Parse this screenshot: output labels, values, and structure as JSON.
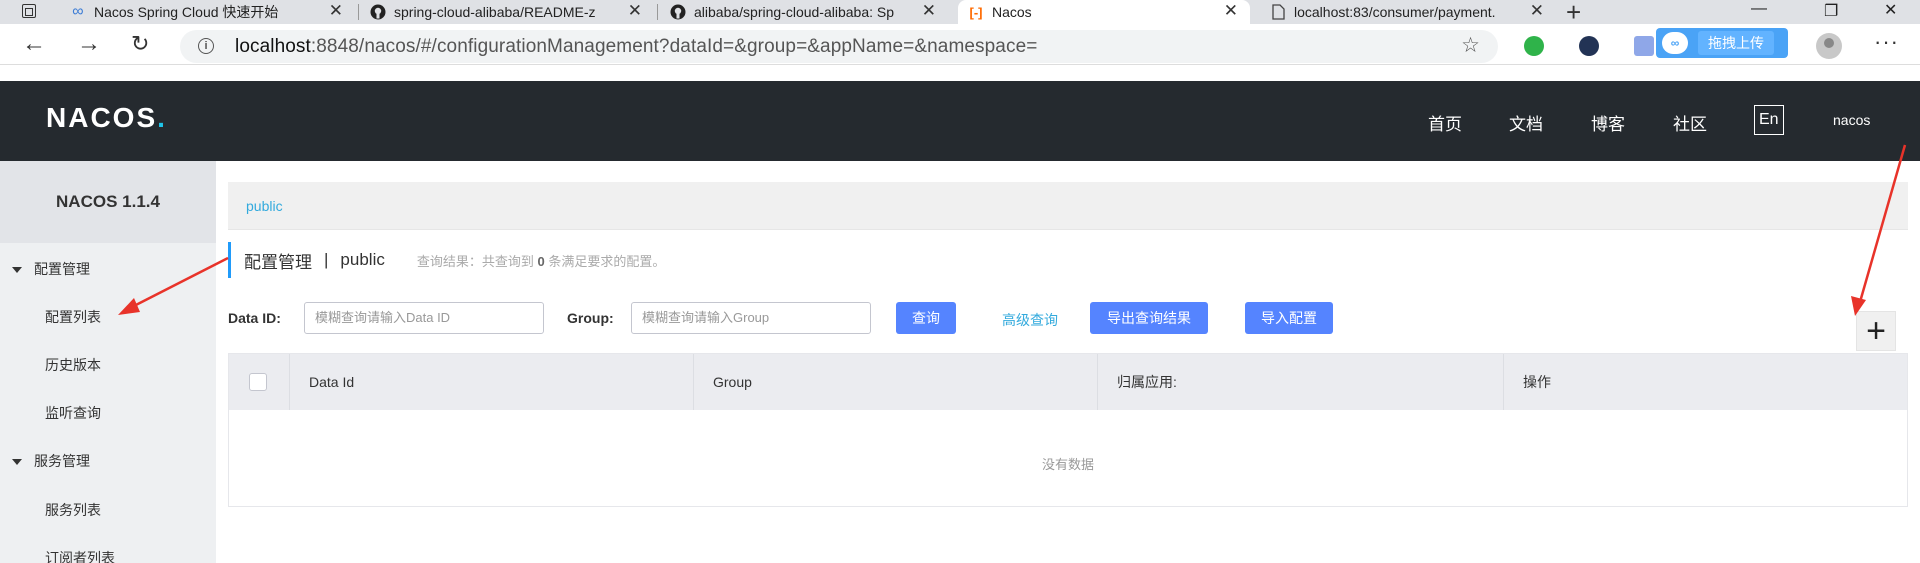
{
  "browser": {
    "tabs": [
      {
        "title": "Nacos Spring Cloud 快速开始",
        "icon": "infinity-icon",
        "color": "#3a7bd5"
      },
      {
        "title": "spring-cloud-alibaba/README-z",
        "icon": "github-icon",
        "color": "#222222"
      },
      {
        "title": "alibaba/spring-cloud-alibaba: Sp",
        "icon": "github-icon",
        "color": "#222222"
      },
      {
        "title": "Nacos",
        "icon": "nacos-bracket-icon",
        "color": "#ff6a00"
      },
      {
        "title": "localhost:83/consumer/payment.",
        "icon": "page-icon",
        "color": "#555555"
      }
    ],
    "url_host": "localhost",
    "url_rest": ":8848/nacos/#/configurationManagement?dataId=&group=&appName=&namespace=",
    "upload_label": "拖拽上传"
  },
  "header": {
    "logo": "NACOS",
    "nav": [
      "首页",
      "文档",
      "博客",
      "社区"
    ],
    "lang": "En",
    "user": "nacos"
  },
  "sidebar": {
    "title": "NACOS 1.1.4",
    "groups": [
      {
        "label": "配置管理",
        "items": [
          "配置列表",
          "历史版本",
          "监听查询"
        ]
      },
      {
        "label": "服务管理",
        "items": [
          "服务列表",
          "订阅者列表"
        ]
      }
    ]
  },
  "main": {
    "breadcrumb": "public",
    "title": "配置管理",
    "title_sep": "|",
    "namespace": "public",
    "result_prefix": "查询结果：共查询到",
    "result_count": "0",
    "result_suffix": "条满足要求的配置。",
    "filters": {
      "dataid_label": "Data ID:",
      "dataid_placeholder": "模糊查询请输入Data ID",
      "group_label": "Group:",
      "group_placeholder": "模糊查询请输入Group"
    },
    "buttons": {
      "query": "查询",
      "advanced": "高级查询",
      "export": "导出查询结果",
      "import": "导入配置",
      "add": "+"
    },
    "table": {
      "columns": [
        "Data Id",
        "Group",
        "归属应用:",
        "操作"
      ],
      "empty": "没有数据"
    }
  },
  "colors": {
    "header_bg": "#252a2f",
    "accent": "#5584ff",
    "link": "#33aadd",
    "annotation": "#e8332a"
  }
}
